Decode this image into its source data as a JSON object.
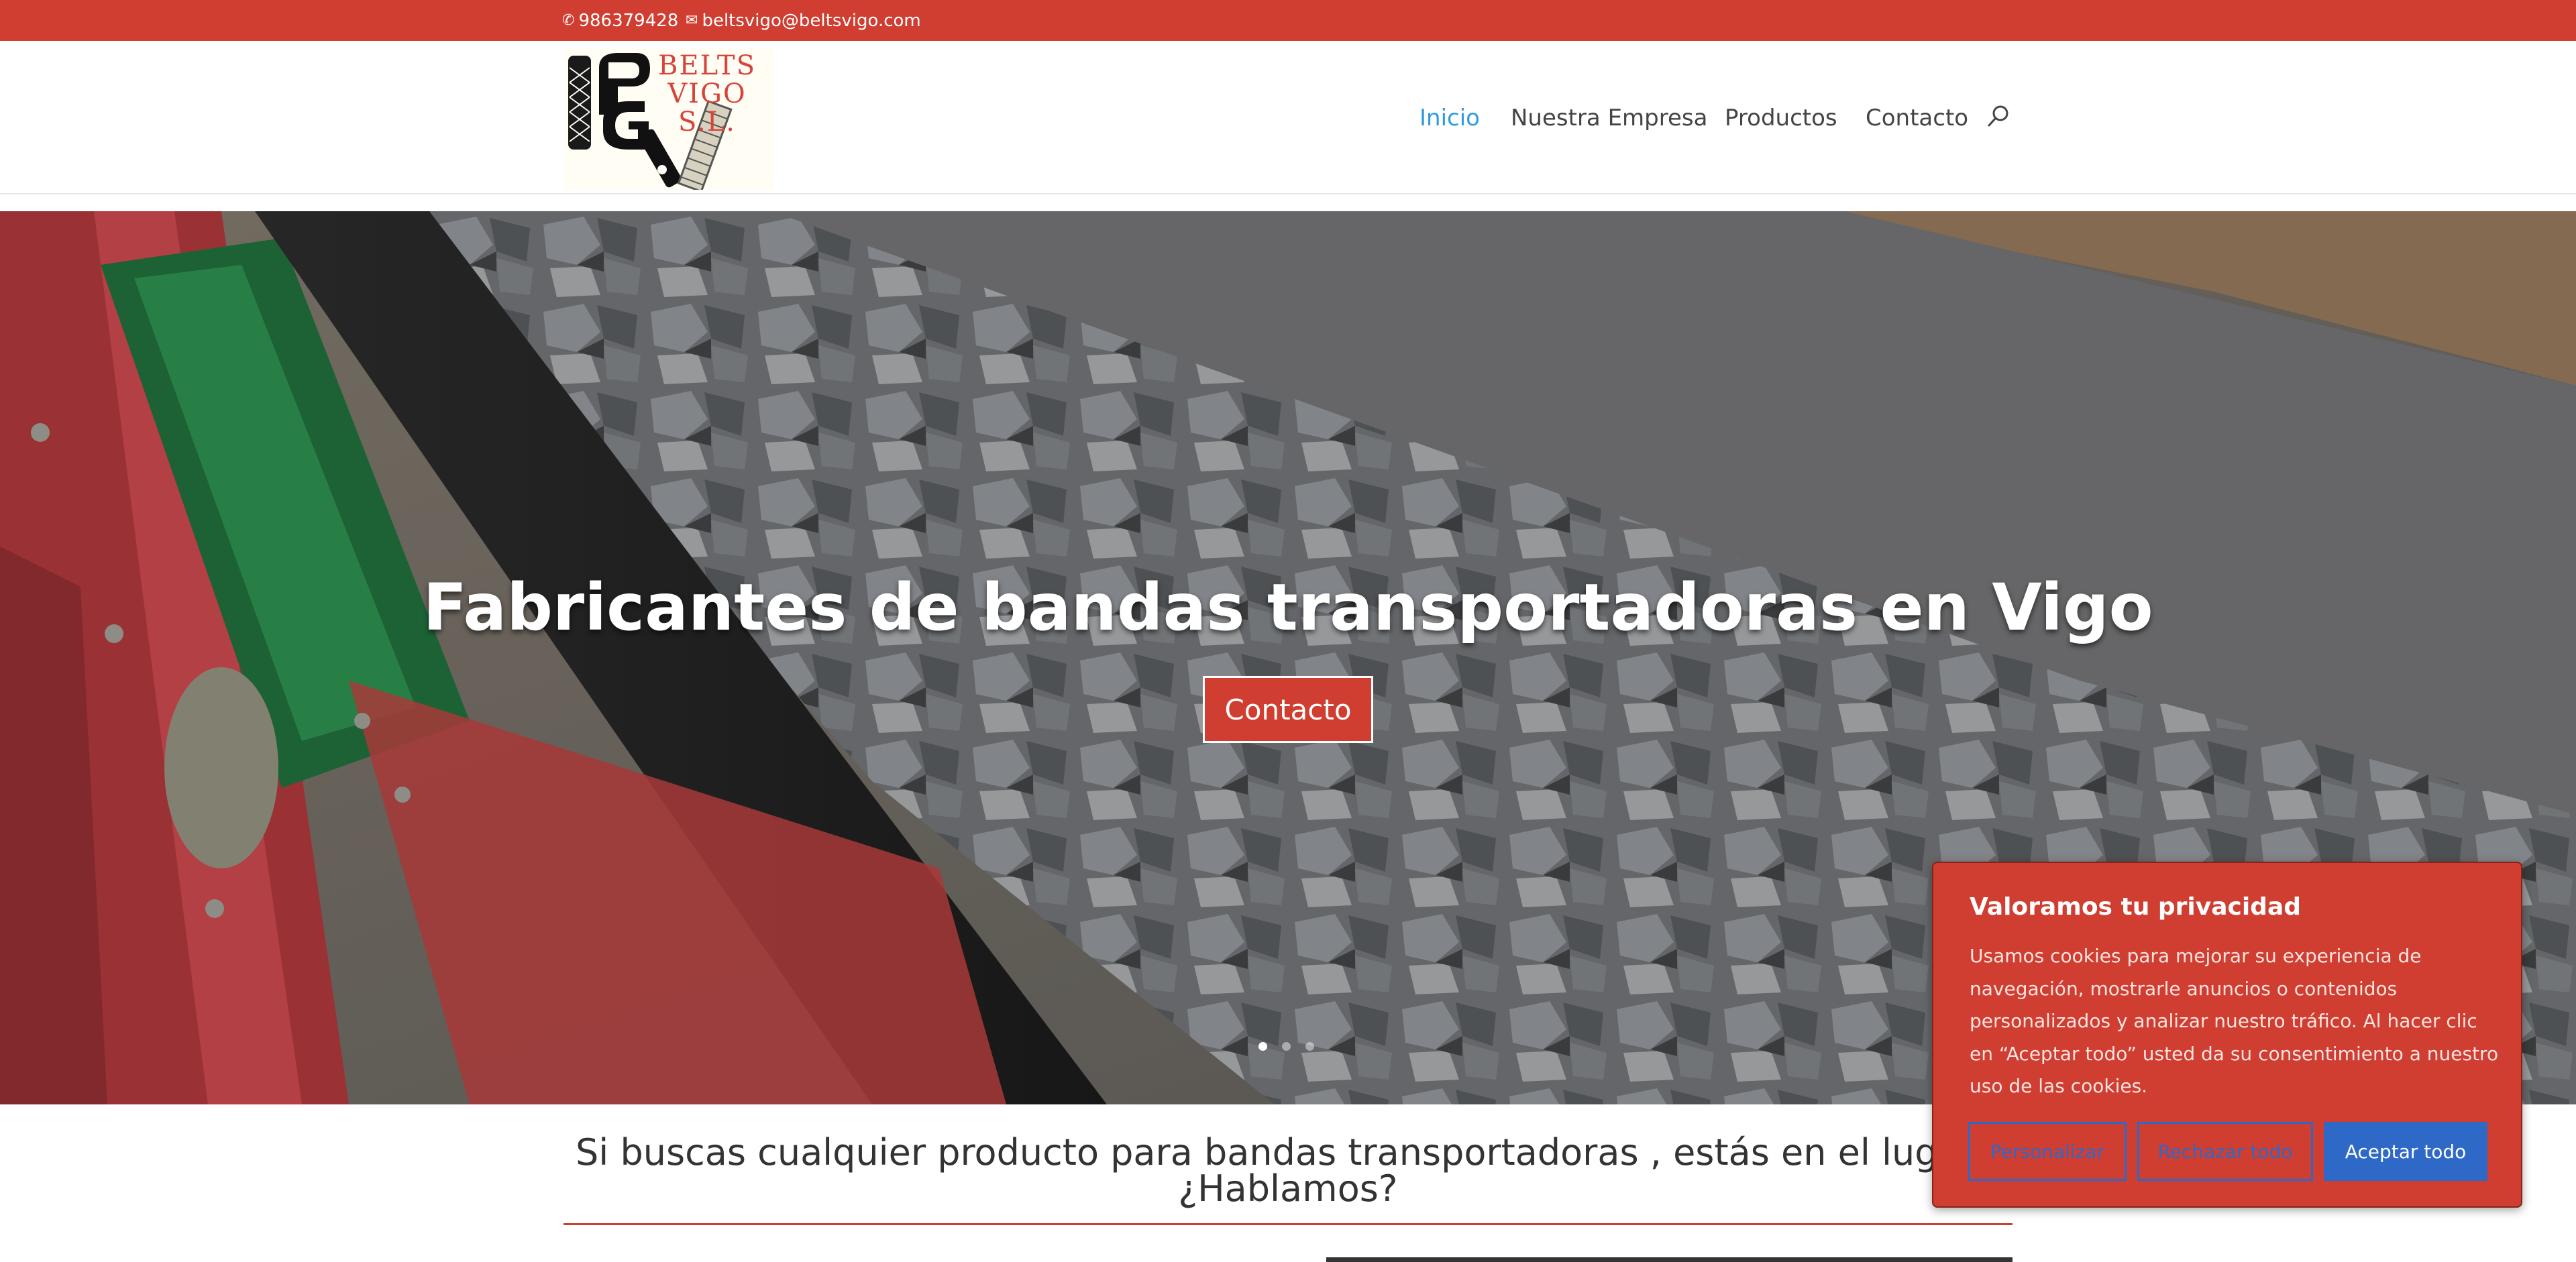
{
  "topbar": {
    "phone": "986379428",
    "email": "beltsvigo@beltsvigo.com"
  },
  "logo": {
    "line1": "BELTS",
    "line2": "VIGO",
    "line3": "S.L."
  },
  "nav": {
    "items": [
      "Inicio",
      "Nuestra Empresa",
      "Productos",
      "Contacto"
    ],
    "active": "Inicio"
  },
  "hero": {
    "title": "Fabricantes de bandas transportadoras en Vigo",
    "button": "Contacto",
    "slides": 3,
    "current_slide": 1
  },
  "intro": {
    "line1": "Si buscas cualquier producto para bandas transportadoras , estás en el lugar adecuado.",
    "line2": "¿Hablamos?"
  },
  "cookie": {
    "title": "Valoramos tu privacidad",
    "text": "Usamos cookies para mejorar su experiencia de navegación, mostrarle anuncios o contenidos personalizados y analizar nuestro tráfico. Al hacer clic en “Aceptar todo” usted da su consentimiento a nuestro uso de las cookies.",
    "customize": "Personalizar",
    "reject": "Rechazar todo",
    "accept": "Aceptar todo"
  },
  "colors": {
    "brand_red": "#d03e31",
    "nav_active": "#2e9be0",
    "cookie_button_blue": "#2f69c7"
  }
}
